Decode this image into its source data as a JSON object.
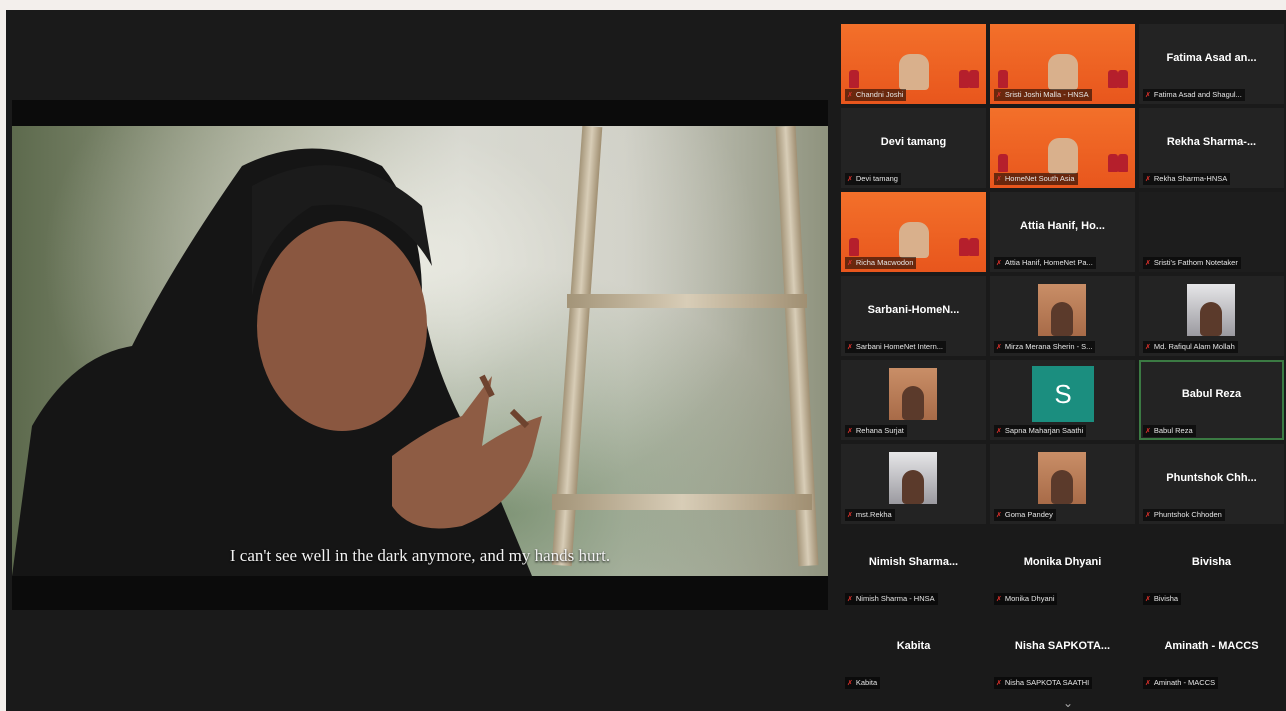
{
  "share": {
    "subtitle": "I can't see well in the dark anymore, and my hands hurt."
  },
  "participants": [
    {
      "tile_name": "",
      "label": "Chandni Joshi",
      "kind": "orange",
      "muted": true
    },
    {
      "tile_name": "",
      "label": "Sristi Joshi Malla - HNSA",
      "kind": "orange",
      "muted": true
    },
    {
      "tile_name": "Fatima Asad an...",
      "label": "Fatima Asad and Shagul...",
      "kind": "name",
      "muted": true
    },
    {
      "tile_name": "Devi tamang",
      "label": "Devi tamang",
      "kind": "name",
      "muted": true
    },
    {
      "tile_name": "",
      "label": "HomeNet South Asia",
      "kind": "orange",
      "muted": true
    },
    {
      "tile_name": "Rekha Sharma-...",
      "label": "Rekha Sharma-HNSA",
      "kind": "name",
      "muted": true
    },
    {
      "tile_name": "",
      "label": "Richa Macwodon",
      "kind": "orange",
      "muted": true
    },
    {
      "tile_name": "Attia Hanif, Ho...",
      "label": "Attia Hanif, HomeNet Pa...",
      "kind": "name",
      "muted": true
    },
    {
      "tile_name": "",
      "label": "Sristi's Fathom Notetaker",
      "kind": "notetaker",
      "muted": true
    },
    {
      "tile_name": "Sarbani-HomeN...",
      "label": "Sarbani HomeNet Intern...",
      "kind": "name",
      "muted": true
    },
    {
      "tile_name": "",
      "label": "Mirza Merana Sherin - S...",
      "kind": "video",
      "muted": true
    },
    {
      "tile_name": "",
      "label": "Md. Rafiqul Alam Mollah",
      "kind": "video",
      "muted": true
    },
    {
      "tile_name": "",
      "label": "Rehana Surjat",
      "kind": "video",
      "muted": true
    },
    {
      "tile_name": "",
      "label": "Sapna Maharjan Saathi",
      "kind": "avatar",
      "avatar": "S",
      "muted": true
    },
    {
      "tile_name": "Babul Reza",
      "label": "Babul Reza",
      "kind": "name",
      "muted": true,
      "active": true
    },
    {
      "tile_name": "",
      "label": "mst.Rekha",
      "kind": "video",
      "muted": true
    },
    {
      "tile_name": "",
      "label": "Goma Pandey",
      "kind": "video",
      "muted": true
    },
    {
      "tile_name": "Phuntshok Chh...",
      "label": "Phuntshok Chhoden",
      "kind": "name",
      "muted": true
    },
    {
      "tile_name": "Nimish Sharma...",
      "label": "Nimish Sharma - HNSA",
      "kind": "name",
      "muted": true
    },
    {
      "tile_name": "Monika Dhyani",
      "label": "Monika Dhyani",
      "kind": "name",
      "muted": true
    },
    {
      "tile_name": "Bivisha",
      "label": "Bivisha",
      "kind": "name",
      "muted": true
    },
    {
      "tile_name": "Kabita",
      "label": "Kabita",
      "kind": "name",
      "muted": true
    },
    {
      "tile_name": "Nisha SAPKOTA...",
      "label": "Nisha SAPKOTA SAATHI",
      "kind": "name",
      "muted": true
    },
    {
      "tile_name": "Aminath - MACCS",
      "label": "Aminath - MACCS",
      "kind": "name",
      "muted": true
    }
  ],
  "colors": {
    "muted_mic": "#e0312b",
    "orange_bg": "#ee6023",
    "active_border": "#3b7a43",
    "avatar_bg": "#1b8e7f"
  },
  "icons": {
    "muted": "mic-muted-icon",
    "scroll_down": "chevron-down-icon"
  },
  "grid_scroll_glyph": "⌄"
}
